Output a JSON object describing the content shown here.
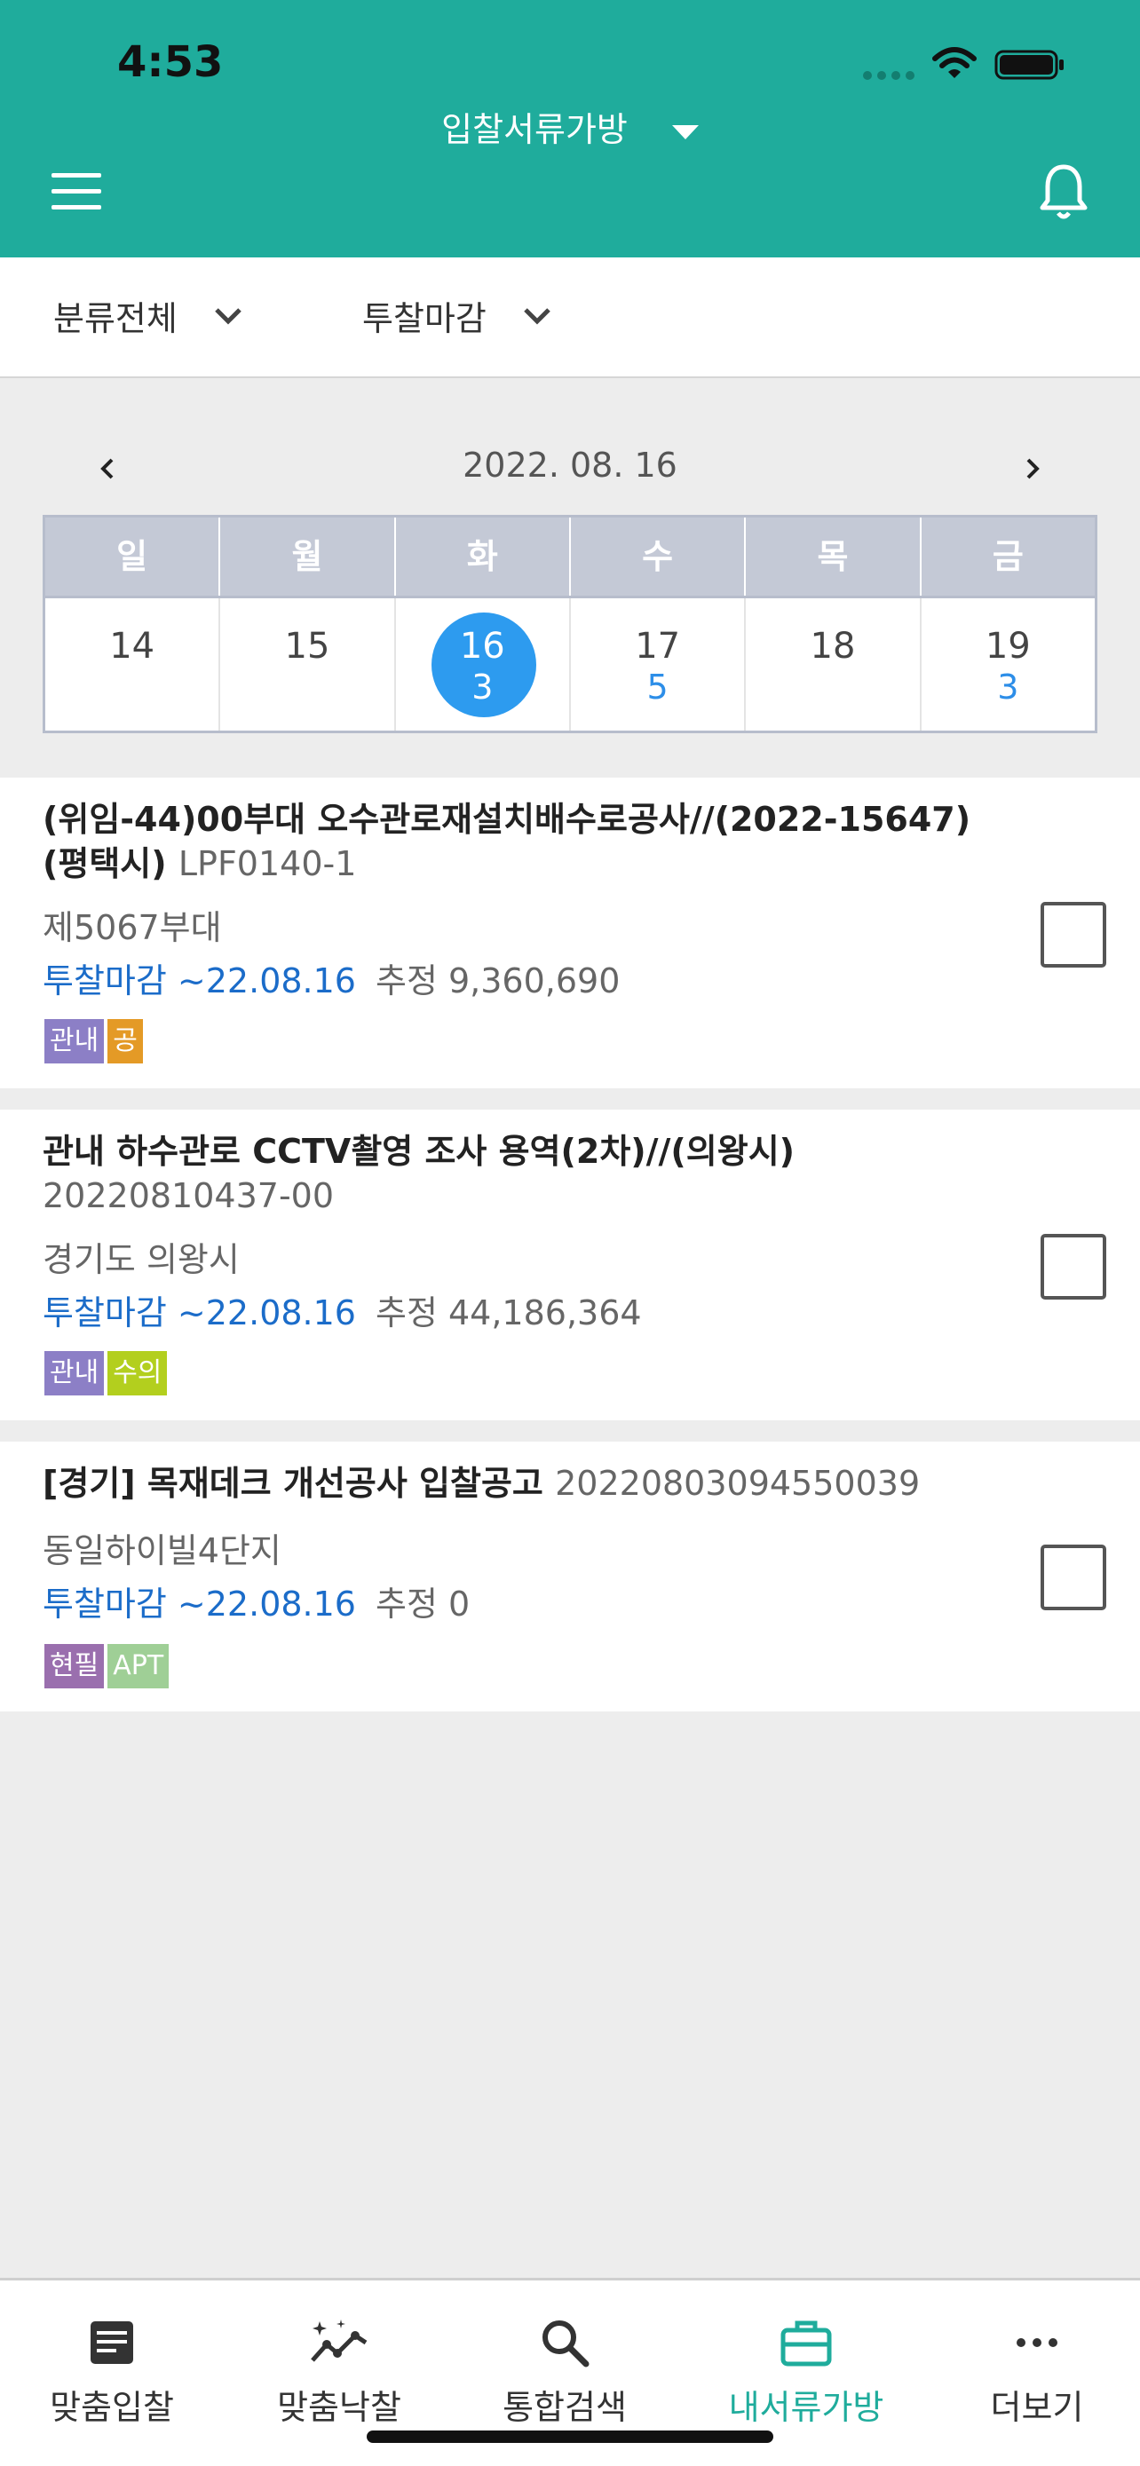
{
  "status_bar": {
    "time": "4:53"
  },
  "header": {
    "title": "입찰서류가방",
    "menu_icon": "hamburger-icon",
    "bell_icon": "bell-icon",
    "accent_color": "#1fac9c"
  },
  "filters": [
    {
      "label": "분류전체"
    },
    {
      "label": "투찰마감"
    }
  ],
  "calendar": {
    "date": "2022. 08. 16",
    "weekdays": [
      "일",
      "월",
      "화",
      "수",
      "목",
      "금"
    ],
    "days": [
      {
        "day": "14",
        "count": ""
      },
      {
        "day": "15",
        "count": ""
      },
      {
        "day": "16",
        "count": "3",
        "selected": true
      },
      {
        "day": "17",
        "count": "5"
      },
      {
        "day": "18",
        "count": ""
      },
      {
        "day": "19",
        "count": "3"
      }
    ]
  },
  "bids": [
    {
      "title": "(위임-44)00부대 오수관로재설치배수로공사//(2022-15647)(평택시)",
      "code": "LPF0140-1",
      "org": "제5067부대",
      "deadline": "투찰마감 ~22.08.16",
      "estimate": "추정 9,360,690",
      "tags": [
        {
          "label": "관내",
          "color": "#8c7fc6"
        },
        {
          "label": "공",
          "color": "#e49a26"
        }
      ]
    },
    {
      "title": "관내 하수관로 CCTV촬영 조사 용역(2차)//(의왕시)",
      "code": "20220810437-00",
      "org": "경기도 의왕시",
      "deadline": "투찰마감 ~22.08.16",
      "estimate": "추정 44,186,364",
      "tags": [
        {
          "label": "관내",
          "color": "#8c7fc6"
        },
        {
          "label": "수의",
          "color": "#b3cf1e"
        }
      ]
    },
    {
      "title": "[경기] 목재데크 개선공사 입찰공고",
      "code": "20220803094550039",
      "org": "동일하이빌4단지",
      "deadline": "투찰마감 ~22.08.16",
      "estimate": "추정 0",
      "tags": [
        {
          "label": "현필",
          "color": "#9a6fae"
        },
        {
          "label": "APT",
          "color": "#9fcf96"
        }
      ]
    }
  ],
  "bottom_nav": [
    {
      "label": "맞춤입찰",
      "icon": "document-icon",
      "active": false
    },
    {
      "label": "맞춤낙찰",
      "icon": "sparkle-chart-icon",
      "active": false
    },
    {
      "label": "통합검색",
      "icon": "search-icon",
      "active": false
    },
    {
      "label": "내서류가방",
      "icon": "briefcase-icon",
      "active": true
    },
    {
      "label": "더보기",
      "icon": "more-icon",
      "active": false
    }
  ]
}
